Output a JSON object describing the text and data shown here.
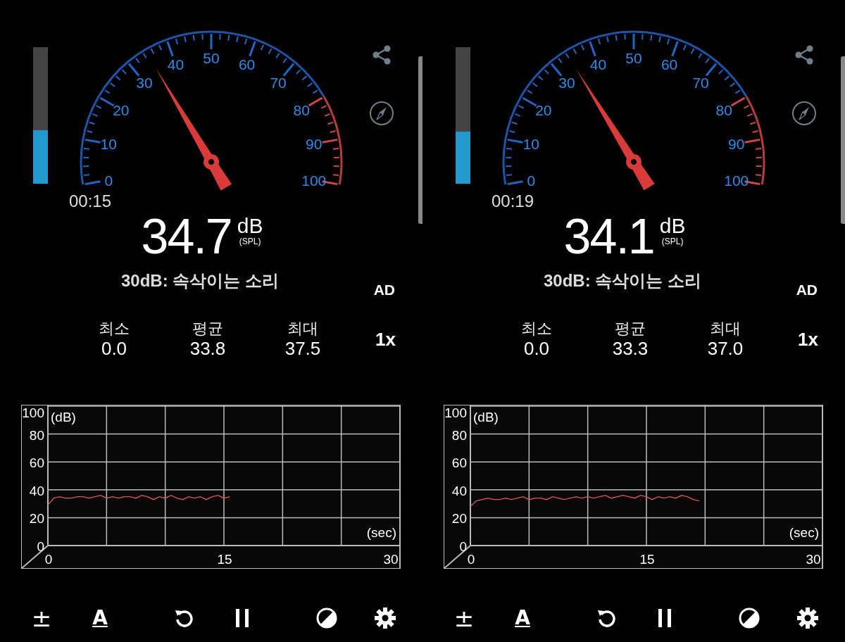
{
  "panels": [
    {
      "level_bar": {
        "level": 0.39
      },
      "gauge": {
        "scale_labels": [
          "0",
          "10",
          "20",
          "30",
          "40",
          "50",
          "60",
          "70",
          "80",
          "90",
          "100"
        ],
        "level": 0.347
      },
      "elapsed": "00:15",
      "reading": "34.7",
      "unit": "dB",
      "unit_note": "(SPL)",
      "description": "30dB: 속삭이는 소리",
      "mode": "AD",
      "stats": [
        {
          "label": "최소",
          "value": "0.0"
        },
        {
          "label": "평균",
          "value": "33.8"
        },
        {
          "label": "최대",
          "value": "37.5"
        }
      ],
      "speed": "1x",
      "chart_data": {
        "type": "line",
        "xlabel": "(sec)",
        "ylabel": "(dB)",
        "x": [
          0,
          0.5,
          1,
          1.5,
          2,
          2.5,
          3,
          3.5,
          4,
          4.5,
          5,
          5.5,
          6,
          6.5,
          7,
          7.5,
          8,
          8.5,
          9,
          9.5,
          10,
          10.5,
          11,
          11.5,
          12,
          12.5,
          13,
          13.5,
          14,
          14.5,
          15,
          15.5
        ],
        "series": [
          {
            "color": "#e05555",
            "values": [
              29,
              34,
              35,
              34,
              34,
              35,
              35,
              34,
              35,
              36,
              34,
              35,
              34,
              35,
              35,
              34,
              36,
              35,
              33,
              35,
              34,
              36,
              34,
              33,
              35,
              34,
              35,
              33,
              35,
              36,
              34,
              35
            ]
          }
        ],
        "xlim": [
          0,
          30
        ],
        "ylim": [
          0,
          100
        ],
        "xticks": [
          0,
          15,
          30
        ],
        "yticks": [
          0,
          20,
          40,
          60,
          80,
          100
        ],
        "grid": true
      },
      "toolbar_glyphs": [
        "±",
        "A"
      ]
    },
    {
      "level_bar": {
        "level": 0.38
      },
      "gauge": {
        "scale_labels": [
          "0",
          "10",
          "20",
          "30",
          "40",
          "50",
          "60",
          "70",
          "80",
          "90",
          "100"
        ],
        "level": 0.341
      },
      "elapsed": "00:19",
      "reading": "34.1",
      "unit": "dB",
      "unit_note": "(SPL)",
      "description": "30dB: 속삭이는 소리",
      "mode": "AD",
      "stats": [
        {
          "label": "최소",
          "value": "0.0"
        },
        {
          "label": "평균",
          "value": "33.3"
        },
        {
          "label": "최대",
          "value": "37.0"
        }
      ],
      "speed": "1x",
      "chart_data": {
        "type": "line",
        "xlabel": "(sec)",
        "ylabel": "(dB)",
        "x": [
          0,
          0.5,
          1,
          1.5,
          2,
          2.5,
          3,
          3.5,
          4,
          4.5,
          5,
          5.5,
          6,
          6.5,
          7,
          7.5,
          8,
          8.5,
          9,
          9.5,
          10,
          10.5,
          11,
          11.5,
          12,
          12.5,
          13,
          13.5,
          14,
          14.5,
          15,
          15.5,
          16,
          16.5,
          17,
          17.5,
          18,
          18.5,
          19,
          19.5
        ],
        "series": [
          {
            "color": "#e05555",
            "values": [
              28,
              32,
              33,
              34,
              33,
              33,
              34,
              33,
              34,
              35,
              33,
              34,
              34,
              33,
              35,
              34,
              33,
              34,
              35,
              34,
              35,
              34,
              35,
              36,
              34,
              35,
              36,
              35,
              34,
              36,
              35,
              33,
              35,
              34,
              35,
              34,
              36,
              35,
              33,
              32
            ]
          }
        ],
        "xlim": [
          0,
          30
        ],
        "ylim": [
          0,
          100
        ],
        "xticks": [
          0,
          15,
          30
        ],
        "yticks": [
          0,
          20,
          40,
          60,
          80,
          100
        ],
        "grid": true
      },
      "toolbar_glyphs": [
        "±",
        "A"
      ]
    }
  ]
}
